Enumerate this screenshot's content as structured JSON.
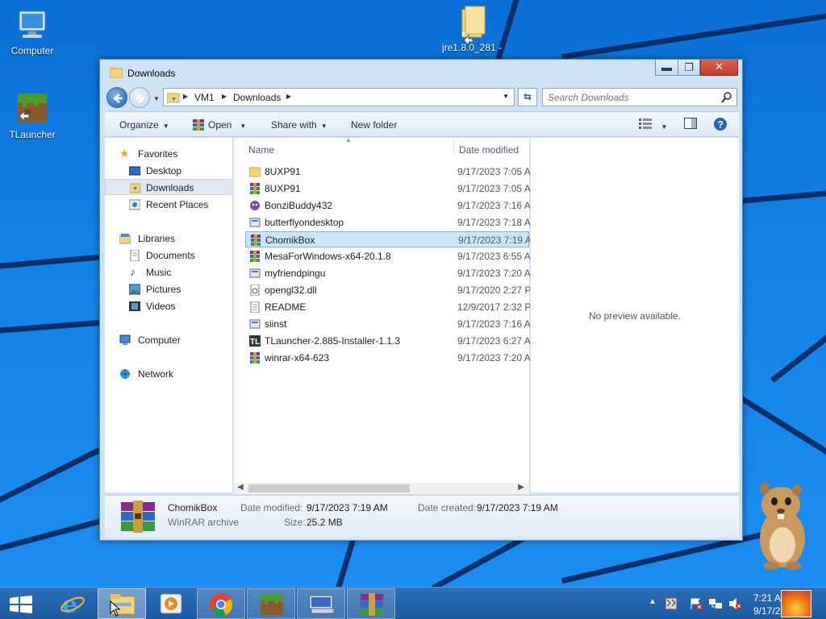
{
  "desktop": {
    "icons": [
      {
        "label": "Computer"
      },
      {
        "label": "TLauncher"
      },
      {
        "label": "jre1.8.0_281 -"
      }
    ]
  },
  "window": {
    "title": "Downloads",
    "controls": {
      "minimize": "▬",
      "maximize": "❐",
      "close": "✕"
    },
    "address": {
      "segments": [
        "VM1",
        "Downloads"
      ]
    },
    "search": {
      "placeholder": "Search Downloads"
    },
    "toolbar": {
      "organize": "Organize",
      "open": "Open",
      "share_with": "Share with",
      "new_folder": "New folder"
    },
    "nav": {
      "favorites": "Favorites",
      "desktop": "Desktop",
      "downloads": "Downloads",
      "recent_places": "Recent Places",
      "libraries": "Libraries",
      "documents": "Documents",
      "music": "Music",
      "pictures": "Pictures",
      "videos": "Videos",
      "computer": "Computer",
      "network": "Network"
    },
    "columns": {
      "name": "Name",
      "date_modified": "Date modified"
    },
    "files": [
      {
        "name": "8UXP91",
        "date": "9/17/2023 7:05 A",
        "icon": "folder-icon"
      },
      {
        "name": "8UXP91",
        "date": "9/17/2023 7:05 A",
        "icon": "winrar-archive-icon"
      },
      {
        "name": "BonziBuddy432",
        "date": "9/17/2023 7:16 A",
        "icon": "bonzibuddy-icon"
      },
      {
        "name": "butterflyondesktop",
        "date": "9/17/2023 7:18 A",
        "icon": "installer-icon"
      },
      {
        "name": "ChomikBox",
        "date": "9/17/2023 7:19 A",
        "icon": "winrar-archive-icon"
      },
      {
        "name": "MesaForWindows-x64-20.1.8",
        "date": "9/17/2023 6:55 A",
        "icon": "winrar-archive-icon"
      },
      {
        "name": "myfriendpingu",
        "date": "9/17/2023 7:20 A",
        "icon": "installer-icon"
      },
      {
        "name": "opengl32.dll",
        "date": "9/17/2020 2:27 P",
        "icon": "dll-file-icon"
      },
      {
        "name": "README",
        "date": "12/9/2017 2:32 P",
        "icon": "text-file-icon"
      },
      {
        "name": "siinst",
        "date": "9/17/2023 7:16 A",
        "icon": "installer-icon"
      },
      {
        "name": "TLauncher-2.885-Installer-1.1.3",
        "date": "9/17/2023 6:27 A",
        "icon": "tlauncher-icon"
      },
      {
        "name": "winrar-x64-623",
        "date": "9/17/2023 7:20 A",
        "icon": "winrar-archive-icon"
      }
    ],
    "selected_file": "ChomikBox",
    "preview": "No preview available.",
    "details": {
      "name": "ChomikBox",
      "type": "WinRAR archive",
      "date_modified_label": "Date modified:",
      "date_modified": "9/17/2023 7:19 AM",
      "date_created_label": "Date created:",
      "date_created": "9/17/2023 7:19 AM",
      "size_label": "Size:",
      "size": "25.2 MB"
    }
  },
  "taskbar": {
    "clock_time": "7:21 A",
    "clock_date": "9/17/2"
  },
  "colors": {
    "accent": "#1b5aa0",
    "selection": "#cce4f7",
    "close_button": "#c23a27"
  }
}
